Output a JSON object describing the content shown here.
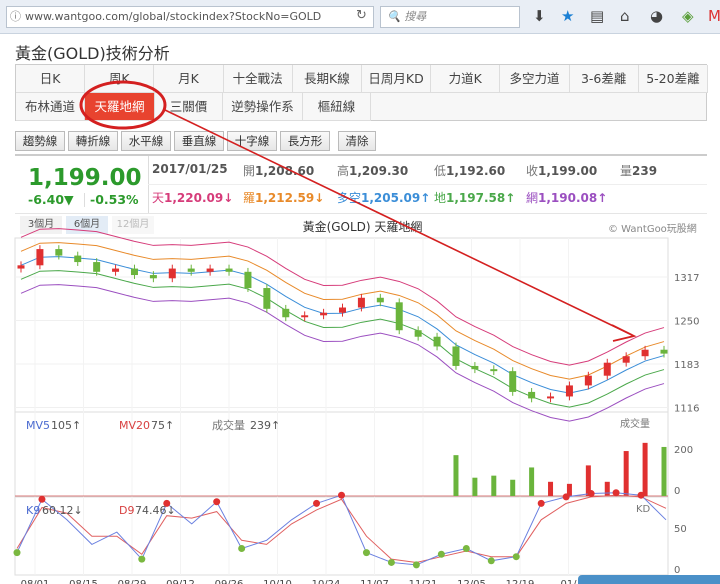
{
  "browser": {
    "url": "www.wantgoo.com/global/stockindex?StockNo=GOLD",
    "search_placeholder": "搜尋"
  },
  "page_title": "黃金(GOLD)技術分析",
  "tabs_row1": [
    "日K",
    "周K",
    "月K",
    "十全戰法",
    "長期K線",
    "日周月KD",
    "力道K",
    "多空力道",
    "3-6差離",
    "5-20差離"
  ],
  "tabs_row2": [
    "布林通道",
    "天羅地網",
    "三關價",
    "逆勢操作系",
    "樞紐線"
  ],
  "active_tab": "天羅地網",
  "tools": [
    "趨勢線",
    "轉折線",
    "水平線",
    "垂直線",
    "十字線",
    "長方形",
    "清除"
  ],
  "quote": {
    "price": "1,199.00",
    "change": "-6.40▼",
    "change_pct": "-0.53%",
    "date": "2017/01/25",
    "open_label": "開",
    "open": "1,208.60",
    "high_label": "高",
    "high": "1,209.30",
    "low_label": "低",
    "low": "1,192.60",
    "close_label": "收",
    "close": "1,199.00",
    "vol_label": "量",
    "vol": "239",
    "tian_label": "天",
    "tian": "1,220.09↓",
    "luo_label": "羅",
    "luo": "1,212.59↓",
    "duokong_label": "多空",
    "duokong": "1,205.09↑",
    "di_label": "地",
    "di": "1,197.58↑",
    "wang_label": "網",
    "wang": "1,190.08↑"
  },
  "periods": [
    "3個月",
    "6個月",
    "12個月"
  ],
  "chart_title": "黃金(GOLD) 天羅地網",
  "copyright": "© WantGoo玩股網",
  "colors": {
    "up": "#e03030",
    "down": "#6ab43c",
    "tian": "#d63c7a",
    "luo": "#e88a2a",
    "duokong": "#3b8ed8",
    "di": "#4aa84a",
    "wang": "#9b4fc0",
    "accent": "#e8432f"
  },
  "chart_data": [
    {
      "type": "candlestick",
      "title": "黃金(GOLD) 天羅地網",
      "y_ticks": [
        1116,
        1183,
        1250,
        1317
      ],
      "ylim": [
        1105,
        1395
      ],
      "x_labels": [
        "08/01",
        "08/15",
        "08/29",
        "09/12",
        "09/26",
        "10/10",
        "10/24",
        "11/07",
        "11/21",
        "12/05",
        "12/19",
        "01/"
      ],
      "close": [
        1335,
        1360,
        1350,
        1340,
        1325,
        1330,
        1320,
        1315,
        1330,
        1325,
        1330,
        1325,
        1300,
        1268,
        1255,
        1258,
        1262,
        1270,
        1285,
        1278,
        1235,
        1225,
        1210,
        1180,
        1175,
        1172,
        1140,
        1130,
        1133,
        1150,
        1165,
        1185,
        1195,
        1205,
        1199
      ]
    },
    {
      "type": "bar",
      "title": "成交量",
      "mv5_label": "MV5",
      "mv5": "105↑",
      "mv20_label": "MV20",
      "mv20": "75↑",
      "vol_label": "成交量",
      "vol": "239↑",
      "y_ticks": [
        0,
        200
      ],
      "values": [
        0,
        0,
        0,
        0,
        0,
        0,
        0,
        0,
        0,
        0,
        0,
        0,
        0,
        0,
        0,
        0,
        0,
        0,
        0,
        0,
        0,
        0,
        0,
        170,
        60,
        70,
        50,
        110,
        40,
        30,
        120,
        40,
        190,
        230,
        210
      ]
    },
    {
      "type": "line",
      "title": "KD",
      "k_label": "K9",
      "k": "60.12↓",
      "d_label": "D9",
      "d": "74.46↓",
      "y_ticks": [
        0,
        50
      ],
      "K": [
        20,
        85,
        60,
        30,
        45,
        12,
        80,
        55,
        82,
        25,
        35,
        60,
        80,
        90,
        20,
        8,
        5,
        18,
        25,
        10,
        15,
        80,
        88,
        92,
        93,
        90,
        60
      ],
      "D": [
        25,
        75,
        68,
        40,
        40,
        18,
        65,
        62,
        70,
        35,
        30,
        55,
        72,
        85,
        40,
        12,
        8,
        15,
        22,
        15,
        15,
        60,
        80,
        88,
        90,
        88,
        74
      ]
    }
  ]
}
